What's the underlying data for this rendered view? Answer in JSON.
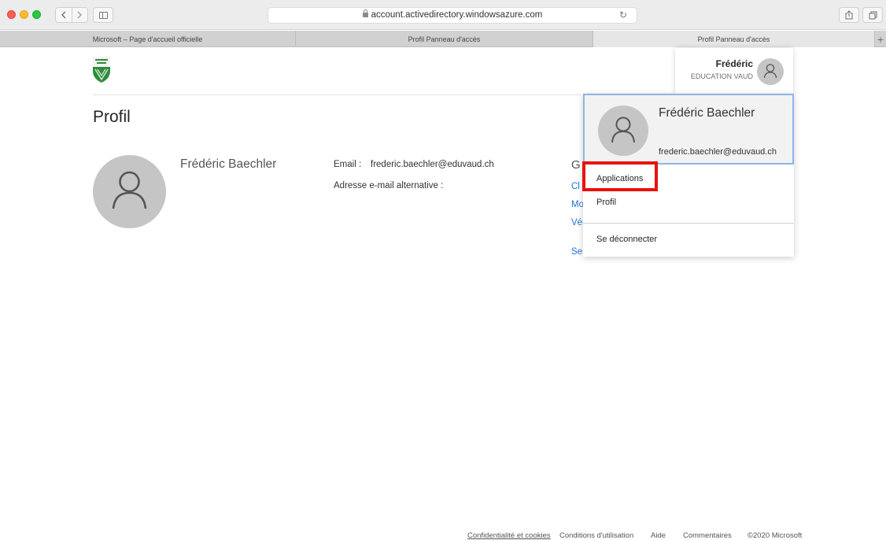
{
  "browser": {
    "url": "account.activedirectory.windowsazure.com",
    "tabs": [
      {
        "label": "Microsoft – Page d'accueil officielle"
      },
      {
        "label": "Profil Panneau d'accès"
      },
      {
        "label": "Profil Panneau d'accès"
      }
    ],
    "icons": [
      "back-icon",
      "forward-icon",
      "sidebar-icon",
      "lock-icon",
      "reload-icon",
      "share-icon",
      "tabs-icon",
      "add-tab-icon"
    ]
  },
  "header": {
    "logo": "canton-vaud-shield-logo",
    "account": {
      "name": "Frédéric",
      "org": "EDUCATION VAUD"
    }
  },
  "profile": {
    "title": "Profil",
    "display_name": "Frédéric Baechler",
    "email_label": "Email :",
    "email_value": "frederic.baechler@eduvaud.ch",
    "alt_email_label": "Adresse e-mail alternative :",
    "side_heading": "G",
    "side_links": [
      "Cl",
      "Mo",
      "Vér",
      "Se"
    ]
  },
  "dropdown": {
    "name": "Frédéric Baechler",
    "email": "frederic.baechler@eduvaud.ch",
    "items": [
      "Applications",
      "Profil",
      "Se déconnecter"
    ],
    "highlighted": "Applications",
    "highlight_color": "#e8130f"
  },
  "footer": {
    "links": [
      "Confidentialité et cookies",
      "Conditions d'utilisation",
      "Aide",
      "Commentaires"
    ],
    "copyright": "©2020 Microsoft"
  }
}
